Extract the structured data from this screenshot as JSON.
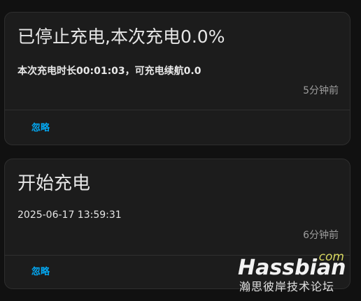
{
  "notifications": [
    {
      "title": "已停止充电,本次充电0.0%",
      "message": "本次充电时长00:01:03，可充电续航0.0",
      "time": "5分钟前",
      "dismiss_label": "忽略"
    },
    {
      "title": "开始充电",
      "message": "2025-06-17 13:59:31",
      "time": "6分钟前",
      "dismiss_label": "忽略"
    }
  ],
  "watermark": {
    "main": "Hassbian",
    "suffix": ".com",
    "subtitle": "瀚思彼岸技术论坛"
  },
  "colors": {
    "background": "#111111",
    "card": "#1c1c1c",
    "accent": "#03a9f4",
    "secondary_text": "#9e9e9e"
  }
}
